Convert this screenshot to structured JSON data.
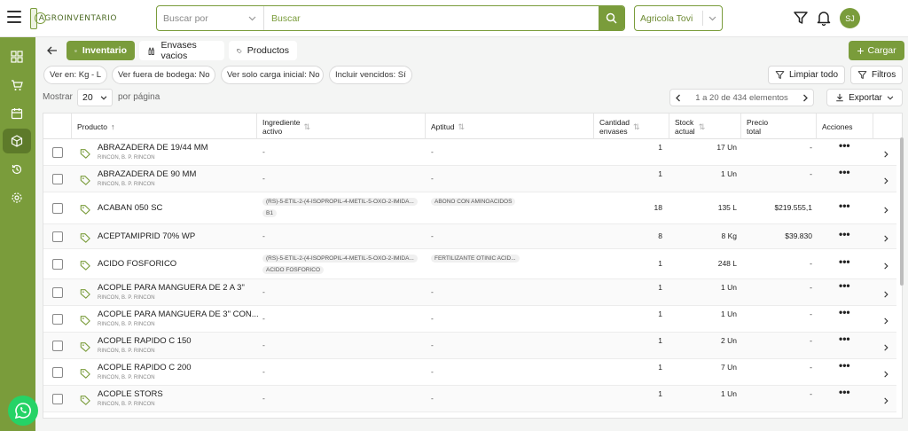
{
  "app": {
    "logo_text": "AGROINVENTARIO",
    "company": "Agricola Tovi",
    "avatar_initials": "SJ"
  },
  "search": {
    "select_placeholder": "Buscar por",
    "placeholder": "Buscar"
  },
  "tabs": [
    {
      "label": "Inventario",
      "active": true
    },
    {
      "label": "Envases vacios",
      "active": false
    },
    {
      "label": "Productos",
      "active": false
    }
  ],
  "cargar_label": "Cargar",
  "filters": [
    "Ver en: Kg - L",
    "Ver fuera de bodega: No",
    "Ver solo carga inicial: No",
    "Incluir vencidos: Sí"
  ],
  "limpiar_label": "Limpiar todo",
  "filtros_label": "Filtros",
  "pagination": {
    "show_label": "Mostrar",
    "page_size": "20",
    "per_page_label": "por página",
    "range_text": "1 a 20 de 434 elementos"
  },
  "export_label": "Exportar",
  "columns": {
    "producto": "Producto",
    "ingrediente": [
      "Ingrediente",
      "activo"
    ],
    "aptitud": "Aptitud",
    "cantidad": [
      "Cantidad",
      "envases"
    ],
    "stock": [
      "Stock",
      "actual"
    ],
    "precio": [
      "Precio",
      "total"
    ],
    "acciones": "Acciones"
  },
  "rows": [
    {
      "name": "ABRAZADERA DE 19/44 MM",
      "sub": "RINCON, B. P. RINCON",
      "ingrediente": "-",
      "aptitud": "-",
      "cantidad": "1",
      "stock": "17 Un",
      "precio": "-"
    },
    {
      "name": "ABRAZADERA DE 90 MM",
      "sub": "RINCON, B. P. RINCON",
      "ingrediente": "-",
      "aptitud": "-",
      "cantidad": "1",
      "stock": "1 Un",
      "precio": "-"
    },
    {
      "name": "ACABAN 050 SC",
      "sub": "",
      "ingrediente": "(RS)-5-ETIL-2-(4-ISOPROPIL-4-METIL-5-OXO-2-IMIDA...",
      "ingrediente2": "B1",
      "aptitud": "ABONO CON AMINOACIDOS",
      "cantidad": "18",
      "stock": "135 L",
      "precio": "$219.555,1"
    },
    {
      "name": "ACEPTAMIPRID 70% WP",
      "sub": "",
      "ingrediente": "-",
      "aptitud": "-",
      "cantidad": "8",
      "stock": "8 Kg",
      "precio": "$39.830"
    },
    {
      "name": "ACIDO FOSFORICO",
      "sub": "",
      "ingrediente": "(RS)-5-ETIL-2-(4-ISOPROPIL-4-METIL-5-OXO-2-IMIDA...",
      "ingrediente2": "ACIDO FOSFORICO",
      "aptitud": "FERTILIZANTE  OTINIC ACID...",
      "cantidad": "1",
      "stock": "248 L",
      "precio": "-"
    },
    {
      "name": "ACOPLE PARA MANGUERA DE 2 A 3\"",
      "sub": "RINCON, B. P. RINCON",
      "ingrediente": "-",
      "aptitud": "-",
      "cantidad": "1",
      "stock": "1 Un",
      "precio": "-"
    },
    {
      "name": "ACOPLE PARA MANGUERA DE 3\" CON...",
      "sub": "RINCON, B. P. RINCON",
      "ingrediente": "-",
      "aptitud": "-",
      "cantidad": "1",
      "stock": "1 Un",
      "precio": "-"
    },
    {
      "name": "ACOPLE RAPIDO C 150",
      "sub": "RINCON, B. P. RINCON",
      "ingrediente": "-",
      "aptitud": "-",
      "cantidad": "1",
      "stock": "2 Un",
      "precio": "-"
    },
    {
      "name": "ACOPLE RAPIDO C 200",
      "sub": "RINCON, B. P. RINCON",
      "ingrediente": "-",
      "aptitud": "-",
      "cantidad": "1",
      "stock": "7 Un",
      "precio": "-"
    },
    {
      "name": "ACOPLE STORS",
      "sub": "RINCON, B. P. RINCON",
      "ingrediente": "-",
      "aptitud": "-",
      "cantidad": "1",
      "stock": "1 Un",
      "precio": "-"
    }
  ],
  "colors": {
    "accent": "#7a9c3b",
    "accent_dark": "#5d7a2a"
  }
}
